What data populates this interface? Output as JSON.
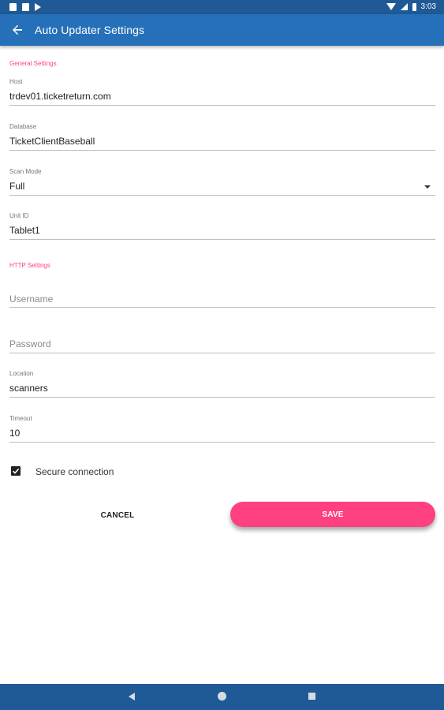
{
  "status_bar": {
    "time": "3:03",
    "icons": [
      "notification-icon",
      "sd-card-icon",
      "play-store-icon",
      "wifi-icon",
      "signal-icon",
      "battery-icon"
    ]
  },
  "app_bar": {
    "title": "Auto Updater Settings",
    "back_icon": "arrow-back-icon"
  },
  "general_settings": {
    "header": "General Settings",
    "host": {
      "label": "Host",
      "value": "trdev01.ticketreturn.com"
    },
    "database": {
      "label": "Database",
      "value": "TicketClientBaseball"
    },
    "scan_mode": {
      "label": "Scan Mode",
      "value": "Full"
    },
    "unit_id": {
      "label": "Unit ID",
      "value": "Tablet1"
    }
  },
  "http_settings": {
    "header": "HTTP Settings",
    "username": {
      "placeholder": "Username"
    },
    "password": {
      "placeholder": "Password"
    },
    "location": {
      "label": "Location",
      "value": "scanners"
    },
    "timeout": {
      "label": "Timeout",
      "value": "10"
    }
  },
  "secure_connection": {
    "label": "Secure connection",
    "checked": true
  },
  "actions": {
    "cancel": "CANCEL",
    "save": "SAVE"
  },
  "colors": {
    "app_bar": "#2670b9",
    "status_bar": "#1f5a96",
    "accent": "#ff4081"
  }
}
